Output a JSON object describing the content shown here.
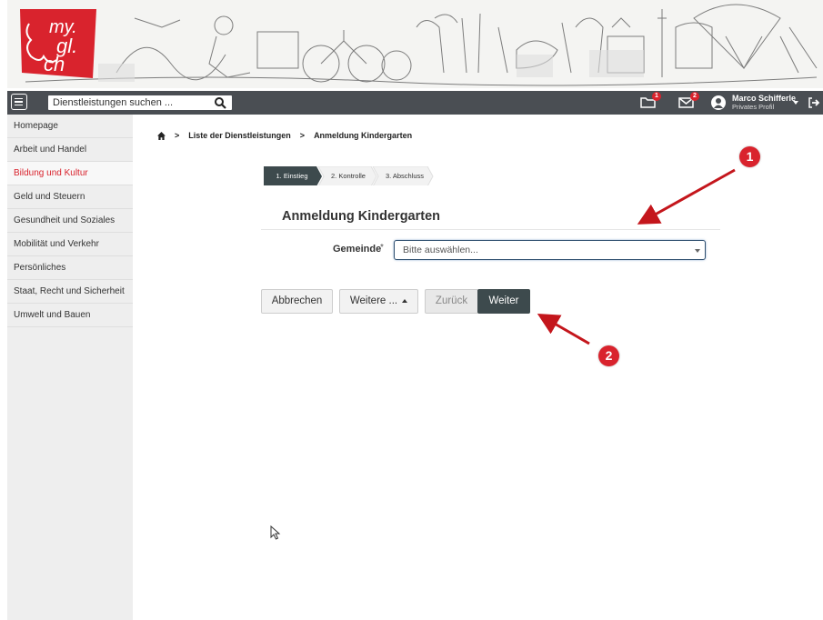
{
  "banner": {
    "logo_text": "my.gl.ch"
  },
  "topbar": {
    "search_placeholder": "Dienstleistungen suchen ...",
    "inbox_badge": "1",
    "mail_badge": "2",
    "user_name": "Marco Schifferle",
    "user_profile": "Privates Profil"
  },
  "sidebar": {
    "items": [
      {
        "label": "Homepage"
      },
      {
        "label": "Arbeit und Handel"
      },
      {
        "label": "Bildung und Kultur"
      },
      {
        "label": "Geld und Steuern"
      },
      {
        "label": "Gesundheit und Soziales"
      },
      {
        "label": "Mobilität und Verkehr"
      },
      {
        "label": "Persönliches"
      },
      {
        "label": "Staat, Recht und Sicherheit"
      },
      {
        "label": "Umwelt und Bauen"
      }
    ],
    "active_index": 2
  },
  "breadcrumb": {
    "items": [
      "Liste der Dienstleistungen",
      "Anmeldung Kindergarten"
    ],
    "separator": ">"
  },
  "steps": [
    "1. Einstieg",
    "2. Kontrolle",
    "3. Abschluss"
  ],
  "form": {
    "title": "Anmeldung Kindergarten",
    "field_label": "Gemeinde",
    "required_marker": "*",
    "select_value": "Bitte auswählen..."
  },
  "buttons": {
    "cancel": "Abbrechen",
    "more": "Weitere ...",
    "back": "Zurück",
    "next": "Weiter"
  },
  "annotations": [
    "1",
    "2"
  ],
  "colors": {
    "accent": "#d9232d",
    "topbar": "#4a4e53",
    "sidebar_bg": "#eeeeee",
    "primary_button": "#3d4a4d"
  }
}
